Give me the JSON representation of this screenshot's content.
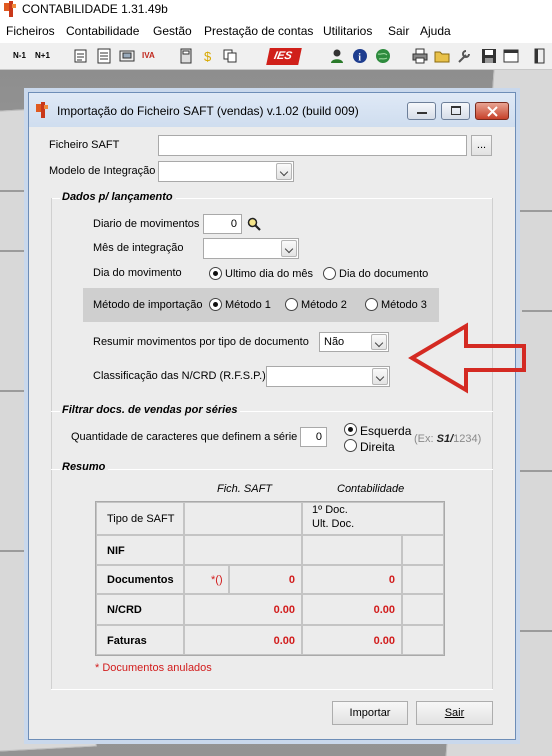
{
  "app": {
    "title": "CONTABILIDADE  1.31.49b"
  },
  "menu": [
    "Ficheiros",
    "Contabilidade",
    "Gestão",
    "Prestação de contas",
    "Utilitarios",
    "Sair",
    "Ajuda"
  ],
  "toolbar": {
    "n1": "N-1",
    "n1plus": "N+1",
    "iva": "IVA",
    "ies": "IES"
  },
  "dialog": {
    "title": "Importação do Ficheiro SAFT (vendas)   v.1.02  (build 009)",
    "ficheiro_saft_label": "Ficheiro SAFT",
    "ficheiro_saft_value": "",
    "browse_label": "...",
    "modelo_label": "Modelo de Integração",
    "modelo_value": "",
    "dados": {
      "title": "Dados p/ lançamento",
      "diario_label": "Diario de movimentos",
      "diario_value": "0",
      "mes_label": "Mês de integração",
      "mes_value": "",
      "dia_label": "Dia do movimento",
      "dia_options": [
        "Ultimo dia do mês",
        "Dia do documento"
      ],
      "metodo_label": "Método de importação",
      "metodo_options": [
        "Método 1",
        "Método 2",
        "Método 3"
      ],
      "resumir_label": "Resumir movimentos por tipo de documento",
      "resumir_value": "Não",
      "classif_label": "Classificação das N/CRD (R.F.S.P.)",
      "classif_value": ""
    },
    "filtrar": {
      "title": "Filtrar docs. de vendas por séries",
      "qtd_label": "Quantidade de caracteres que definem a série",
      "qtd_value": "0",
      "opt_esquerda": "Esquerda",
      "opt_direita": "Direita",
      "ex_prefix": "(Ex: ",
      "ex_bold": "S1/",
      "ex_suffix": "1234)"
    },
    "resumo": {
      "title": "Resumo",
      "col_fich": "Fich. SAFT",
      "col_contab": "Contabilidade",
      "tipo_label": "Tipo de SAFT",
      "doc1": "1º Doc.",
      "ult_doc": "Ult. Doc.",
      "rows": [
        {
          "label": "NIF",
          "fich": "",
          "contab": ""
        },
        {
          "label": "Documentos",
          "mark": "*()",
          "fich": "0",
          "contab": "0"
        },
        {
          "label": "N/CRD",
          "fich": "0.00",
          "contab": "0.00"
        },
        {
          "label": "Faturas",
          "fich": "0.00",
          "contab": "0.00"
        }
      ],
      "footnote": "* Documentos anulados"
    },
    "btn_importar": "Importar",
    "btn_sair": "Sair"
  },
  "colors": {
    "accent_red": "#d21c1c",
    "arrow_red": "#d42a22"
  }
}
